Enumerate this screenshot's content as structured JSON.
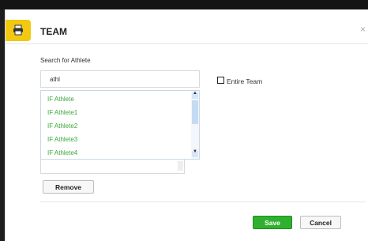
{
  "dialog": {
    "title": "TEAM",
    "close_glyph": "×"
  },
  "search": {
    "label": "Search for Athlete",
    "value": "athl"
  },
  "entire_team": {
    "label": "Entire Team",
    "checked": false
  },
  "results": {
    "items": [
      "IF Athlete",
      "IF Athlete1",
      "IF Athlete2",
      "IF Athlete3",
      "IF Athlete4"
    ]
  },
  "buttons": {
    "remove": "Remove",
    "save": "Save",
    "cancel": "Cancel"
  },
  "icons": {
    "print": "printer-icon"
  },
  "colors": {
    "accent_yellow": "#f2c811",
    "save_green": "#2fb12f",
    "list_text_green": "#3aa63a"
  }
}
